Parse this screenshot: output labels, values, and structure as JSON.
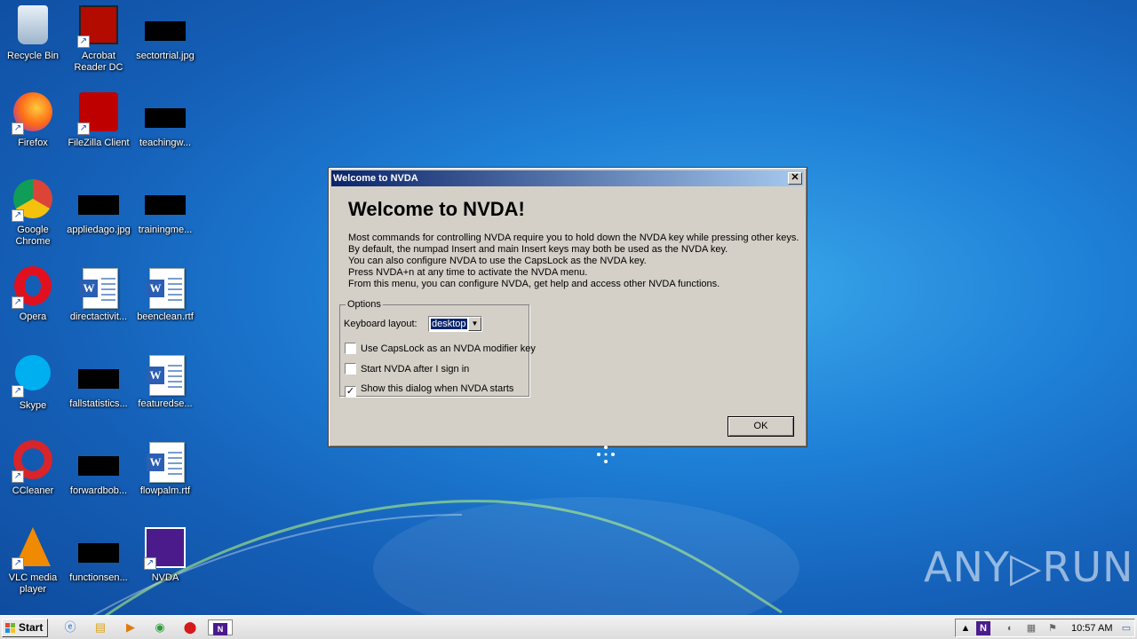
{
  "desktop": {
    "icons": [
      {
        "label": "Recycle Bin",
        "icon": "recycle-bin-icon"
      },
      {
        "label": "Acrobat Reader DC",
        "icon": "acrobat-icon"
      },
      {
        "label": "sectortrial.jpg",
        "icon": "redacted-file-icon"
      },
      {
        "label": "Firefox",
        "icon": "firefox-icon"
      },
      {
        "label": "FileZilla Client",
        "icon": "filezilla-icon"
      },
      {
        "label": "teachingw...",
        "icon": "redacted-file-icon"
      },
      {
        "label": "Google Chrome",
        "icon": "chrome-icon"
      },
      {
        "label": "appliedago.jpg",
        "icon": "redacted-file-icon"
      },
      {
        "label": "trainingme...",
        "icon": "redacted-file-icon"
      },
      {
        "label": "Opera",
        "icon": "opera-icon"
      },
      {
        "label": "directactivit...",
        "icon": "word-doc-icon"
      },
      {
        "label": "beenclean.rtf",
        "icon": "word-doc-icon"
      },
      {
        "label": "Skype",
        "icon": "skype-icon"
      },
      {
        "label": "fallstatistics...",
        "icon": "redacted-file-icon"
      },
      {
        "label": "featuredse...",
        "icon": "word-doc-icon"
      },
      {
        "label": "CCleaner",
        "icon": "ccleaner-icon"
      },
      {
        "label": "forwardbob...",
        "icon": "redacted-file-icon"
      },
      {
        "label": "flowpalm.rtf",
        "icon": "word-doc-icon"
      },
      {
        "label": "VLC media player",
        "icon": "vlc-icon"
      },
      {
        "label": "functionsen...",
        "icon": "redacted-file-icon"
      },
      {
        "label": "NVDA",
        "icon": "nvda-icon"
      }
    ]
  },
  "dialog": {
    "title": "Welcome to NVDA",
    "heading": "Welcome to NVDA!",
    "body_lines": [
      "Most commands for controlling NVDA require you to hold down the NVDA key while pressing other keys.",
      "By default, the numpad Insert and main Insert keys may both be used as the NVDA key.",
      "You can also configure NVDA to use the CapsLock as the NVDA key.",
      "Press NVDA+n at any time to activate the NVDA menu.",
      "From this menu, you can configure NVDA, get help and access other NVDA functions."
    ],
    "options_legend": "Options",
    "keyboard_layout_label": "Keyboard layout:",
    "keyboard_layout_value": "desktop",
    "checkboxes": [
      {
        "label": "Use CapsLock as an NVDA modifier key",
        "checked": false
      },
      {
        "label": "Start NVDA after I sign in",
        "checked": false
      },
      {
        "label": "Show this dialog when NVDA starts",
        "checked": true
      }
    ],
    "ok_label": "OK",
    "close_glyph": "✕"
  },
  "watermark": "ANY▷RUN",
  "taskbar": {
    "start_label": "Start",
    "items": [
      "ie-icon",
      "explorer-icon",
      "media-player-icon",
      "chrome-icon",
      "opera-icon",
      "nvda-icon"
    ],
    "tray_icons": [
      "show-hidden-icon",
      "nvda-tray-icon",
      "volume-icon",
      "network-icon",
      "action-center-flag-icon"
    ],
    "clock": "10:57 AM"
  }
}
